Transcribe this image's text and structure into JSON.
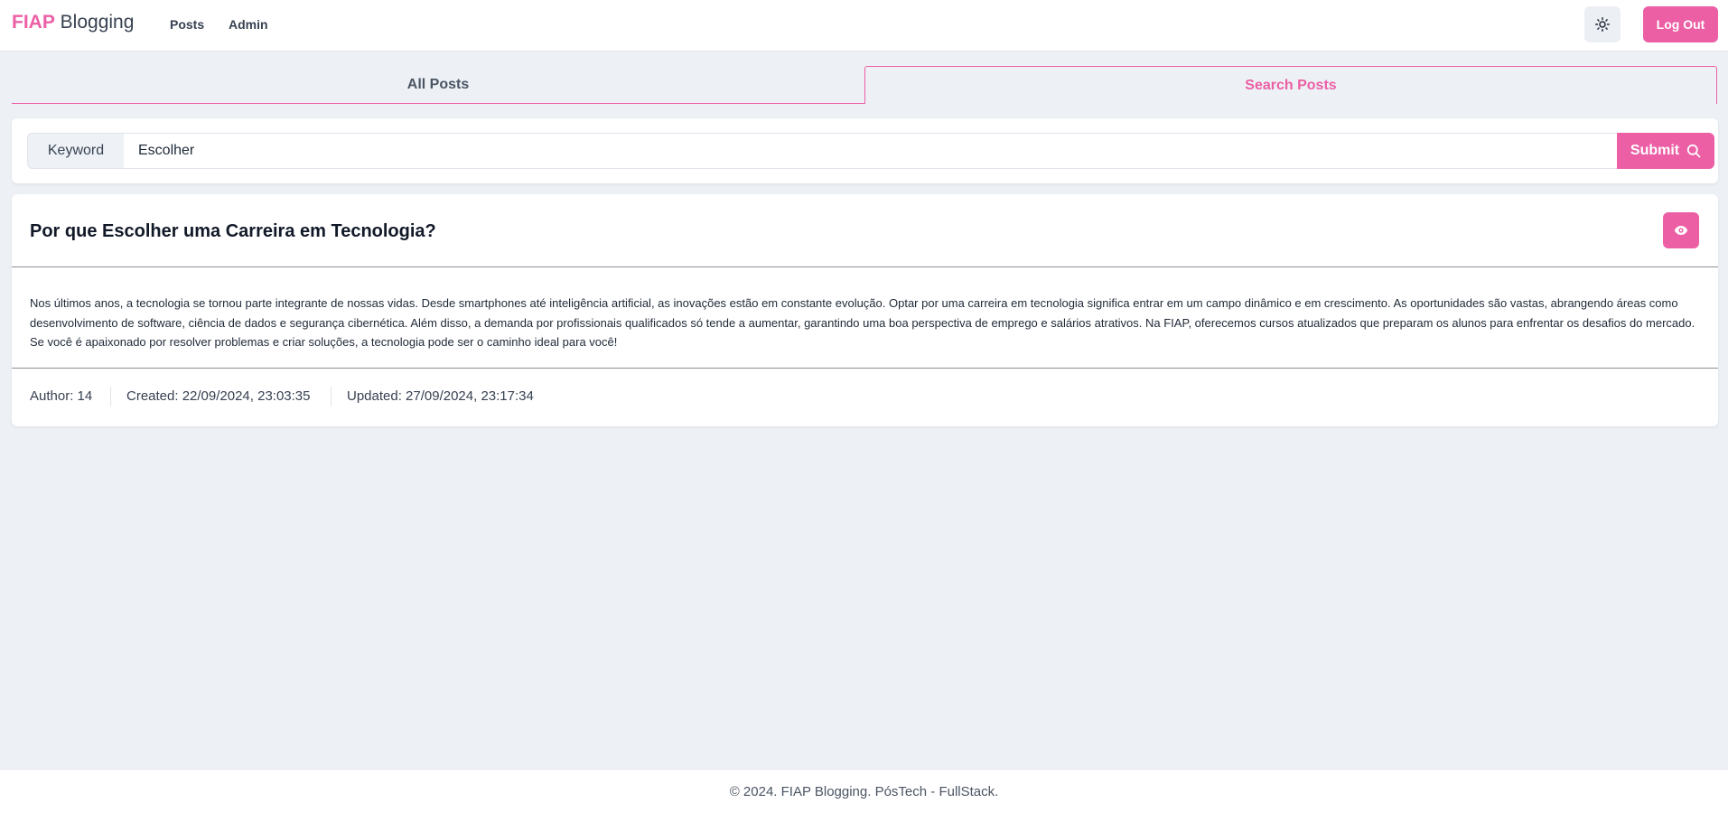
{
  "header": {
    "brand_accent": "FIAP",
    "brand_rest": " Blogging",
    "nav": {
      "posts": "Posts",
      "admin": "Admin"
    },
    "theme_icon": "sun-icon",
    "logout_label": "Log Out"
  },
  "tabs": [
    {
      "label": "All Posts",
      "active": false
    },
    {
      "label": "Search Posts",
      "active": true
    }
  ],
  "search": {
    "addon_label": "Keyword",
    "value": "Escolher",
    "submit_label": "Submit",
    "submit_icon": "search-icon"
  },
  "post": {
    "title": "Por que Escolher uma Carreira em Tecnologia?",
    "view_icon": "eye-icon",
    "body": "Nos últimos anos, a tecnologia se tornou parte integrante de nossas vidas. Desde smartphones até inteligência artificial, as inovações estão em constante evolução. Optar por uma carreira em tecnologia significa entrar em um campo dinâmico e em crescimento. As oportunidades são vastas, abrangendo áreas como desenvolvimento de software, ciência de dados e segurança cibernética. Além disso, a demanda por profissionais qualificados só tende a aumentar, garantindo uma boa perspectiva de emprego e salários atrativos. Na FIAP, oferecemos cursos atualizados que preparam os alunos para enfrentar os desafios do mercado. Se você é apaixonado por resolver problemas e criar soluções, a tecnologia pode ser o caminho ideal para você!",
    "author": "Author: 14",
    "created": "Created: 22/09/2024, 23:03:35",
    "updated": "Updated: 27/09/2024, 23:17:34"
  },
  "footer": {
    "text": "© 2024. FIAP Blogging. PósTech - FullStack."
  },
  "colors": {
    "accent": "#ec5fa5",
    "background": "#edf1f5",
    "surface": "#ffffff"
  }
}
